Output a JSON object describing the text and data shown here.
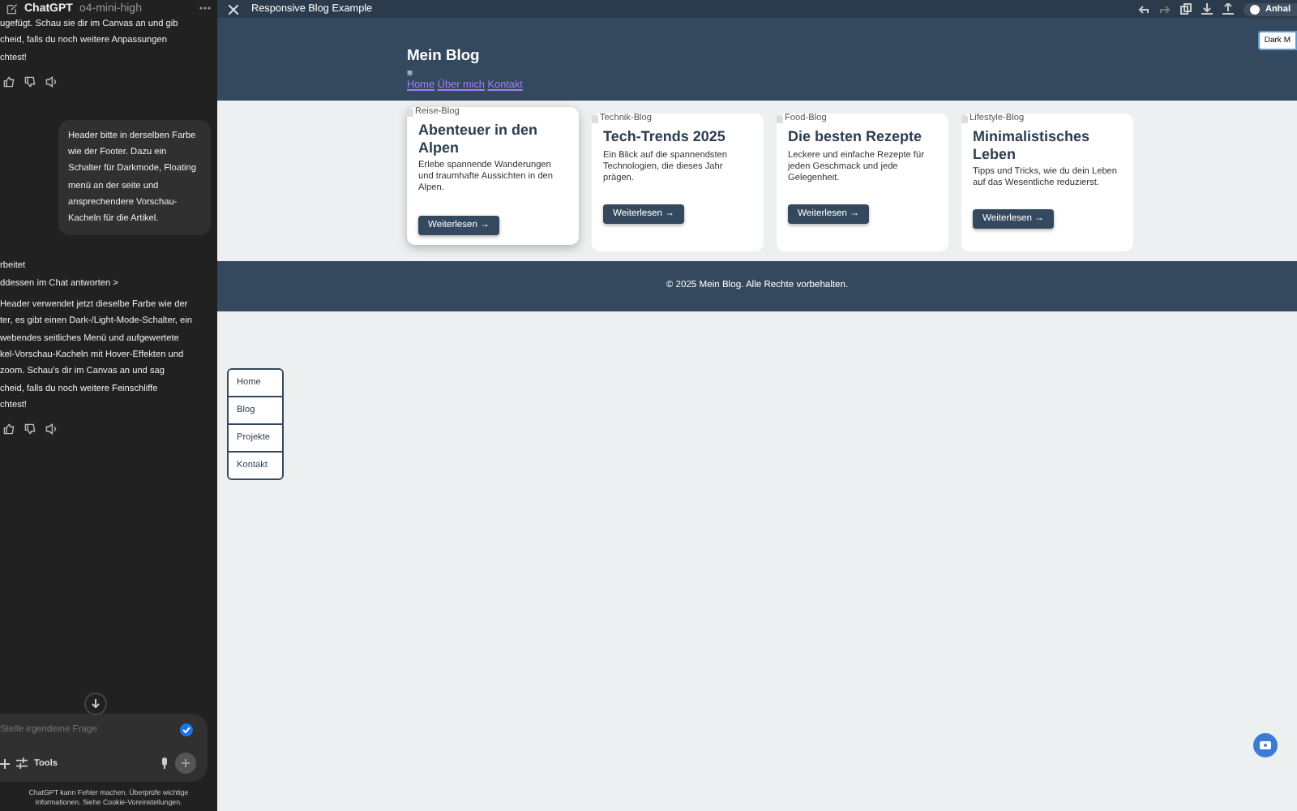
{
  "chat": {
    "title": "ChatGPT",
    "model": "o4-mini-high",
    "messages": [
      {
        "kind": "assistant",
        "text": "ugefügt. Schau sie dir im Canvas an und gib\ncheid, falls du noch weitere Anpassungen\nchtest!"
      },
      {
        "kind": "user",
        "text": "Header bitte in derselben Farbe wie der Footer. Dazu ein Schalter für Darkmode, Floating menü an der seite und ansprechendere Vorschau-Kacheln für die Artikel."
      },
      {
        "kind": "status",
        "text": "rbeitet"
      },
      {
        "kind": "link",
        "text": "ddessen im Chat antworten >"
      },
      {
        "kind": "assistant",
        "text": "Header verwendet jetzt dieselbe Farbe wie der\nter, es gibt einen Dark-/Light-Mode-Schalter, ein\nwebendes seitliches Menü und aufgewertete\nkel-Vorschau-Kacheln mit Hover-Effekten und\nzoom. Schau's dir im Canvas an und sag\ncheid, falls du noch weitere Feinschliffe\nchtest!"
      }
    ],
    "input": {
      "placeholder": "Stelle irgendeine Frage",
      "tools": "Tools"
    },
    "disclaimer": "ChatGPT kann Fehler machen. Überprüfe wichtige Informationen. Siehe Cookie-Voreinstellungen."
  },
  "canvas": {
    "title": "Responsive Blog Example",
    "share": "Anhal",
    "site": {
      "title": "Mein Blog",
      "menu_glyph": "≡",
      "nav": [
        "Home",
        "Über mich",
        "Kontakt"
      ],
      "theme_toggle": "Dark M",
      "cards": [
        {
          "image_alt": "Reise-Blog",
          "title": "Abenteuer in den Alpen",
          "text": "Erlebe spannende Wanderungen und traumhafte Aussichten in den Alpen.",
          "button": "Weiterlesen →",
          "hovered": true
        },
        {
          "image_alt": "Technik-Blog",
          "title": "Tech-Trends 2025",
          "text": "Ein Blick auf die spannendsten Technologien, die dieses Jahr prägen.",
          "button": "Weiterlesen →",
          "hovered": false
        },
        {
          "image_alt": "Food-Blog",
          "title": "Die besten Rezepte",
          "text": "Leckere und einfache Rezepte für jeden Geschmack und jede Gelegenheit.",
          "button": "Weiterlesen →",
          "hovered": false
        },
        {
          "image_alt": "Lifestyle-Blog",
          "title": "Minimalistisches Leben",
          "text": "Tipps und Tricks, wie du dein Leben auf das Wesentliche reduzierst.",
          "button": "Weiterlesen →",
          "hovered": false
        }
      ],
      "footer": "© 2025 Mein Blog. Alle Rechte vorbehalten.",
      "floating_menu": [
        "Home",
        "Blog",
        "Projekte",
        "Kontakt"
      ]
    }
  }
}
